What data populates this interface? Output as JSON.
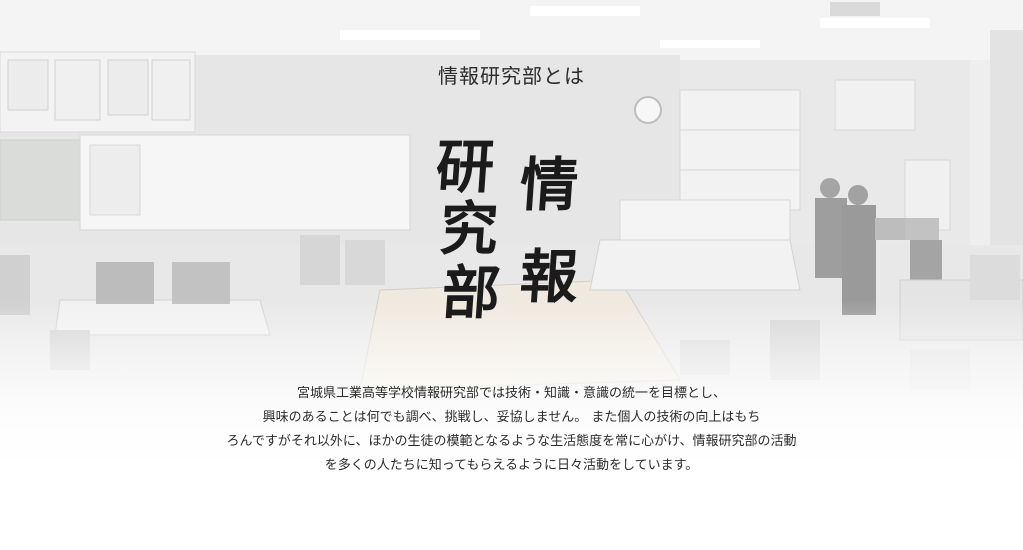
{
  "section": {
    "title": "情報研究部とは",
    "logo": {
      "column_right": [
        "情",
        "報"
      ],
      "column_left": [
        "研",
        "究",
        "部"
      ]
    },
    "description_lines": [
      "宮城県工業高等学校情報研究部では技術・知識・意識の統一を目標とし、",
      "興味のあることは何でも調べ、挑戦し、妥協しません。 また個人の技術の向上はもち",
      "ろんですがそれ以外に、ほかの生徒の模範となるような生活態度を常に心がけ、情報研究部の活動",
      "を多くの人たちに知ってもらえるように日々活動をしています。"
    ]
  }
}
